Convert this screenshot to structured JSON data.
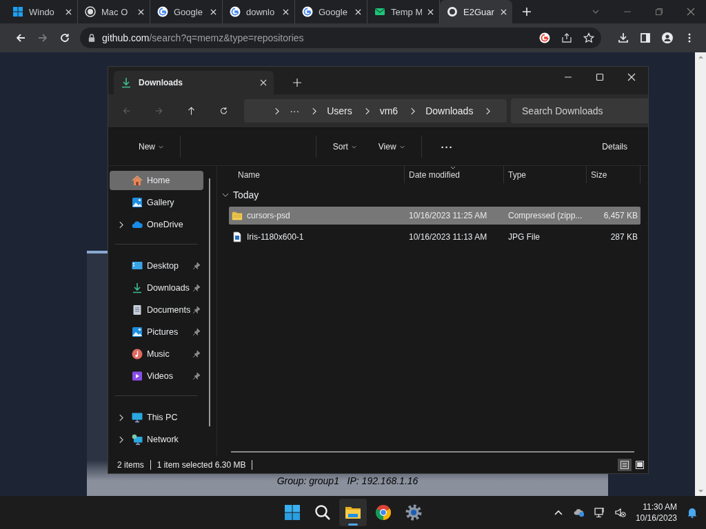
{
  "browser": {
    "tabs": [
      {
        "title": "Windo",
        "kind": "windows",
        "selected": false
      },
      {
        "title": "Mac O",
        "kind": "wordpress",
        "selected": false
      },
      {
        "title": "Google",
        "kind": "google",
        "selected": false
      },
      {
        "title": "downlo",
        "kind": "google",
        "selected": false
      },
      {
        "title": "Google",
        "kind": "google",
        "selected": false
      },
      {
        "title": "Temp M",
        "kind": "mail",
        "selected": false
      },
      {
        "title": "E2Guar",
        "kind": "github",
        "selected": true
      }
    ],
    "address": {
      "domain": "github.com",
      "path": "/search?q=memz&type=repositories"
    }
  },
  "page": {
    "caption": "Group: group1   IP: 192.168.1.16"
  },
  "explorer": {
    "tab_title": "Downloads",
    "breadcrumb": [
      "···",
      "Users",
      "vm6",
      "Downloads"
    ],
    "search": {
      "placeholder": "Search Downloads"
    },
    "commands": {
      "new": "New",
      "sort": "Sort",
      "view": "View",
      "more": "···",
      "details": "Details"
    },
    "sidebar": [
      [
        {
          "label": "Home",
          "kind": "home",
          "expandable": false,
          "pinned": false,
          "selected": true
        },
        {
          "label": "Gallery",
          "kind": "gallery",
          "expandable": false,
          "pinned": false,
          "selected": false
        },
        {
          "label": "OneDrive",
          "kind": "cloud",
          "expandable": true,
          "pinned": false,
          "selected": false
        }
      ],
      [
        {
          "label": "Desktop",
          "kind": "desktop",
          "expandable": false,
          "pinned": true,
          "selected": false
        },
        {
          "label": "Downloads",
          "kind": "download",
          "expandable": false,
          "pinned": true,
          "selected": false
        },
        {
          "label": "Documents",
          "kind": "document",
          "expandable": false,
          "pinned": true,
          "selected": false
        },
        {
          "label": "Pictures",
          "kind": "gallery",
          "expandable": false,
          "pinned": true,
          "selected": false
        },
        {
          "label": "Music",
          "kind": "music",
          "expandable": false,
          "pinned": true,
          "selected": false
        },
        {
          "label": "Videos",
          "kind": "video",
          "expandable": false,
          "pinned": true,
          "selected": false
        }
      ],
      [
        {
          "label": "This PC",
          "kind": "pc",
          "expandable": true,
          "pinned": false,
          "selected": false
        },
        {
          "label": "Network",
          "kind": "network",
          "expandable": true,
          "pinned": false,
          "selected": false
        }
      ]
    ],
    "columns": [
      {
        "label": "Name",
        "sorted": false
      },
      {
        "label": "Date modified",
        "sorted": true
      },
      {
        "label": "Type",
        "sorted": false
      },
      {
        "label": "Size",
        "sorted": false
      }
    ],
    "group": "Today",
    "rows": [
      {
        "name": "cursors-psd",
        "kind": "zip",
        "date": "10/16/2023 11:25 AM",
        "type": "Compressed (zipp...",
        "size": "6,457 KB",
        "selected": true
      },
      {
        "name": "Iris-1180x600-1",
        "kind": "image",
        "date": "10/16/2023 11:13 AM",
        "type": "JPG File",
        "size": "287 KB",
        "selected": false
      }
    ],
    "status": {
      "items": "2 items",
      "selection": "1 item selected  6.30 MB"
    },
    "views": [
      {
        "kind": "details",
        "selected": true
      },
      {
        "kind": "tiles",
        "selected": false
      }
    ]
  },
  "taskbar": {
    "apps": [
      {
        "kind": "start",
        "selected": false
      },
      {
        "kind": "search",
        "selected": false
      },
      {
        "kind": "explorer",
        "selected": true
      },
      {
        "kind": "chrome",
        "selected": false
      },
      {
        "kind": "settings",
        "selected": false
      }
    ],
    "time": "11:30 AM",
    "date": "10/16/2023"
  }
}
